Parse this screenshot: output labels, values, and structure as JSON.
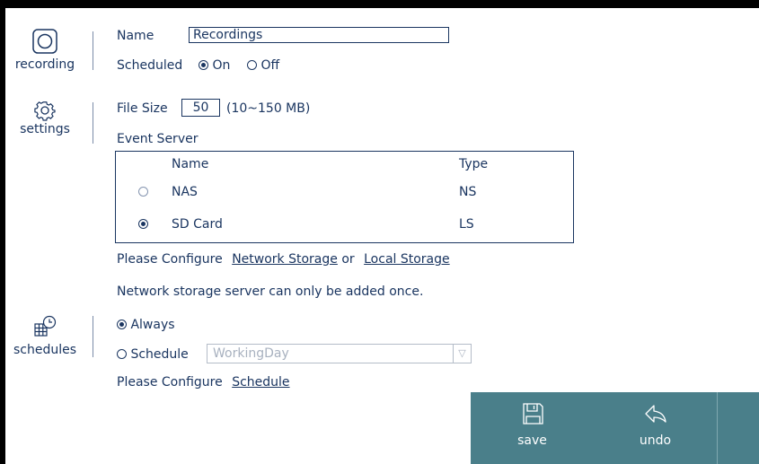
{
  "sidebar": {
    "recording_label": "recording",
    "settings_label": "settings",
    "schedules_label": "schedules"
  },
  "recording": {
    "name_label": "Name",
    "name_value": "Recordings",
    "scheduled_label": "Scheduled",
    "on_label": "On",
    "off_label": "Off",
    "scheduled_selected": "On"
  },
  "settings": {
    "file_size_label": "File Size",
    "file_size_value": "50",
    "file_size_range": "(10~150 MB)",
    "event_server_label": "Event Server",
    "table": {
      "col_name": "Name",
      "col_type": "Type",
      "rows": [
        {
          "name": "NAS",
          "type": "NS",
          "selected": false
        },
        {
          "name": "SD Card",
          "type": "LS",
          "selected": true
        }
      ]
    },
    "configure_prefix": "Please Configure",
    "network_storage_link": "Network Storage",
    "or_text": "or",
    "local_storage_link": "Local Storage",
    "note": "Network storage server can only be added once."
  },
  "schedules": {
    "always_label": "Always",
    "schedule_label": "Schedule",
    "selected": "Always",
    "schedule_select_value": "WorkingDay",
    "configure_prefix": "Please Configure",
    "schedule_link": "Schedule"
  },
  "toolbar": {
    "save_label": "save",
    "undo_label": "undo"
  },
  "colors": {
    "text": "#1a3560",
    "toolbar_bg": "#4a7f8a",
    "disabled": "#a8b1bf"
  },
  "icons": [
    "recording-icon",
    "gear-icon",
    "calendar-clock-icon",
    "save-icon",
    "undo-icon"
  ]
}
